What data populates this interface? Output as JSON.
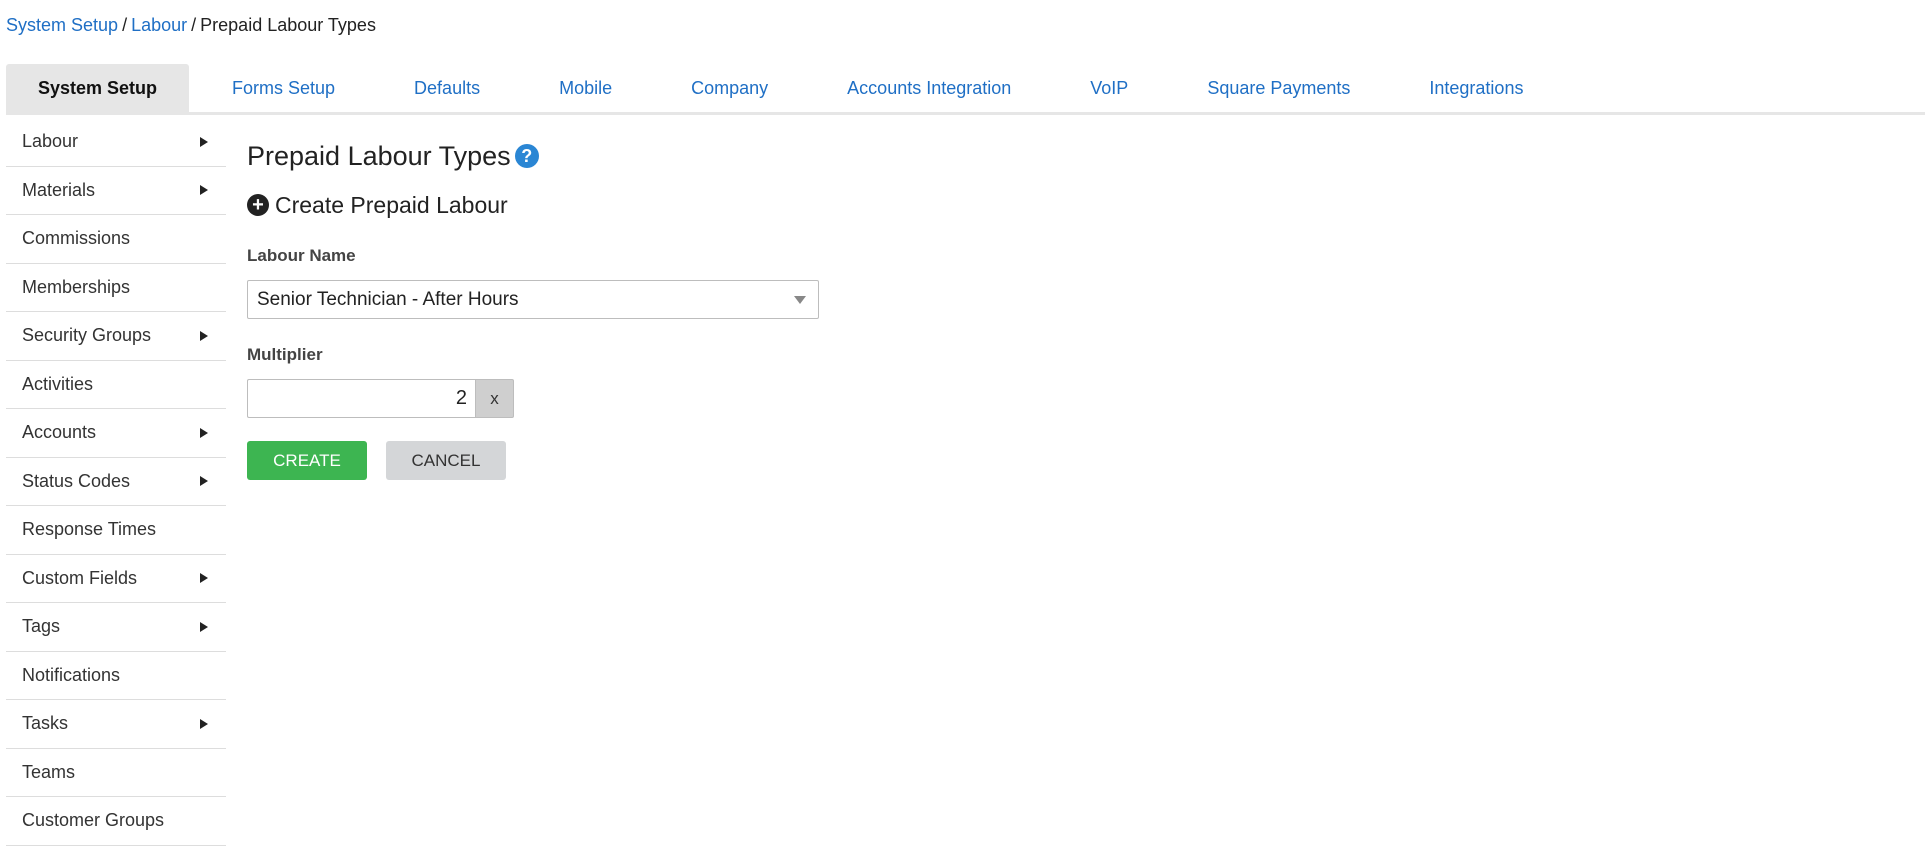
{
  "breadcrumb": {
    "items": [
      "System Setup",
      "Labour"
    ],
    "current": "Prepaid Labour Types",
    "separator": "/"
  },
  "tabs": [
    {
      "label": "System Setup",
      "active": true
    },
    {
      "label": "Forms Setup"
    },
    {
      "label": "Defaults"
    },
    {
      "label": "Mobile"
    },
    {
      "label": "Company"
    },
    {
      "label": "Accounts Integration"
    },
    {
      "label": "VoIP"
    },
    {
      "label": "Square Payments"
    },
    {
      "label": "Integrations"
    }
  ],
  "sidebar": {
    "items": [
      {
        "label": "Labour",
        "submenu": true
      },
      {
        "label": "Materials",
        "submenu": true
      },
      {
        "label": "Commissions",
        "submenu": false
      },
      {
        "label": "Memberships",
        "submenu": false
      },
      {
        "label": "Security Groups",
        "submenu": true
      },
      {
        "label": "Activities",
        "submenu": false
      },
      {
        "label": "Accounts",
        "submenu": true
      },
      {
        "label": "Status Codes",
        "submenu": true
      },
      {
        "label": "Response Times",
        "submenu": false
      },
      {
        "label": "Custom Fields",
        "submenu": true
      },
      {
        "label": "Tags",
        "submenu": true
      },
      {
        "label": "Notifications",
        "submenu": false
      },
      {
        "label": "Tasks",
        "submenu": true
      },
      {
        "label": "Teams",
        "submenu": false
      },
      {
        "label": "Customer Groups",
        "submenu": false
      }
    ]
  },
  "main": {
    "title": "Prepaid Labour Types",
    "help_glyph": "?",
    "plus_glyph": "+",
    "create_heading": "Create Prepaid Labour",
    "labour_name_label": "Labour Name",
    "labour_name_value": "Senior Technician - After Hours",
    "multiplier_label": "Multiplier",
    "multiplier_value": "2",
    "multiplier_suffix": "x",
    "create_button": "CREATE",
    "cancel_button": "CANCEL"
  },
  "colors": {
    "link": "#1f6fc5",
    "create": "#3db551",
    "cancel": "#d4d6d8",
    "help": "#2a86d4"
  }
}
